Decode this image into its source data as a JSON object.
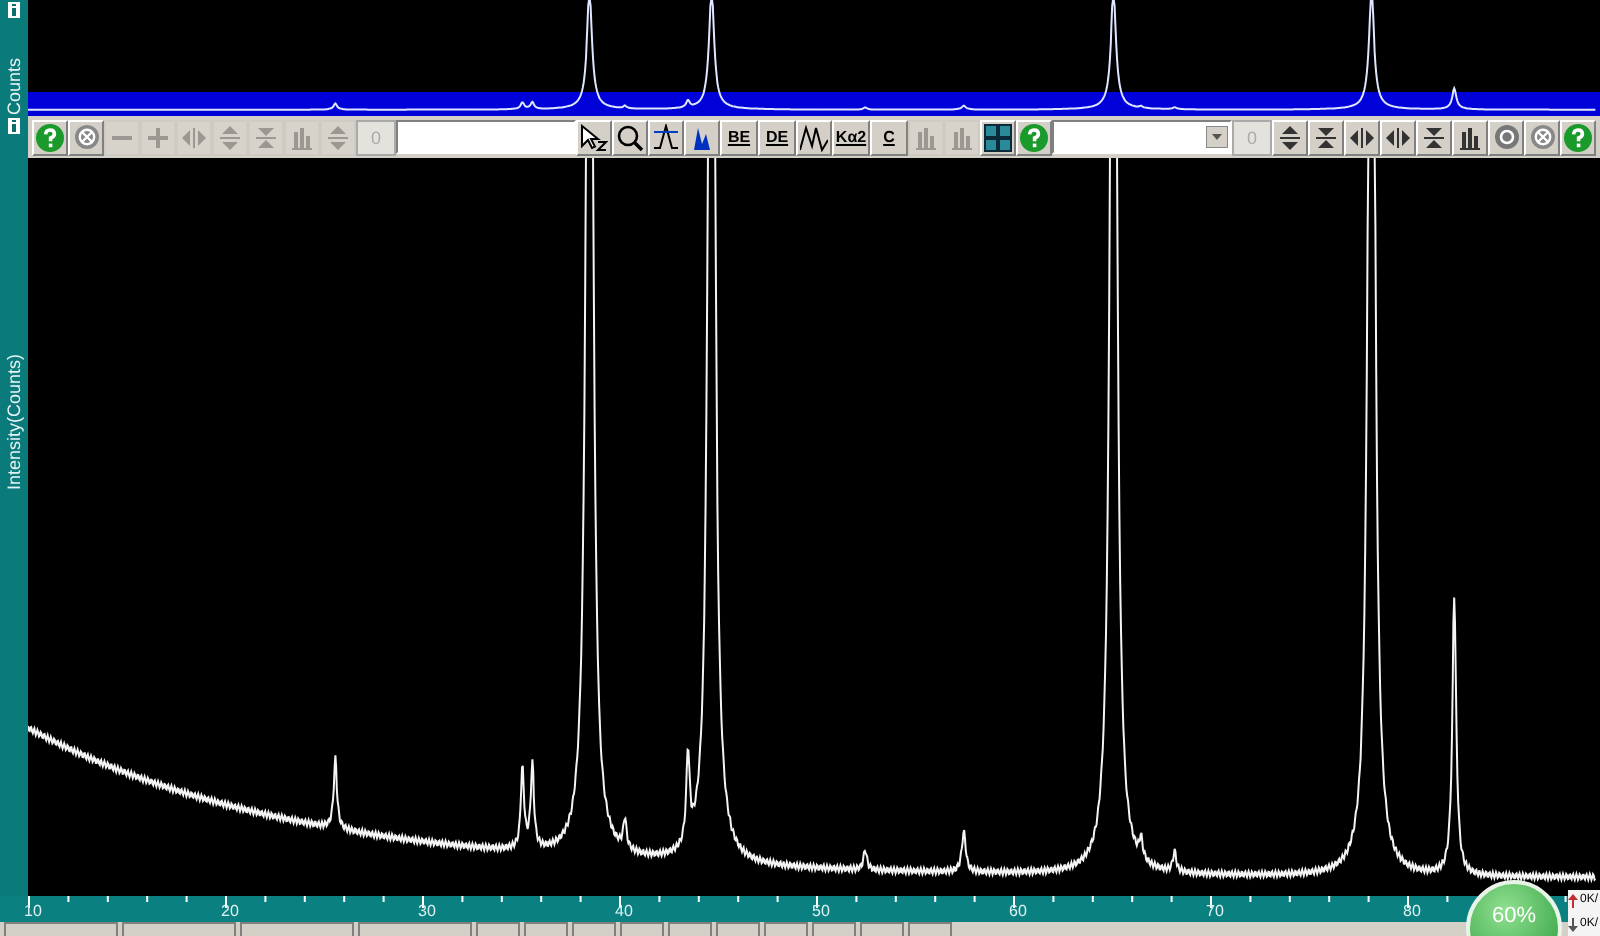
{
  "overview": {
    "axis_label": "Counts"
  },
  "toolbar_left": [
    {
      "kind": "help",
      "disabled": false
    },
    {
      "kind": "cancel",
      "disabled": false
    },
    {
      "kind": "minus",
      "disabled": true
    },
    {
      "kind": "plus",
      "disabled": true
    },
    {
      "kind": "split",
      "disabled": true
    },
    {
      "kind": "updown",
      "disabled": true
    },
    {
      "kind": "join",
      "disabled": true
    },
    {
      "kind": "bars",
      "disabled": true
    },
    {
      "kind": "updown",
      "disabled": true
    },
    {
      "kind": "number",
      "label": "0",
      "disabled": true
    },
    {
      "kind": "input"
    },
    {
      "kind": "cursor",
      "disabled": false
    },
    {
      "kind": "zoom",
      "disabled": false
    },
    {
      "kind": "background",
      "disabled": false
    },
    {
      "kind": "peaks",
      "disabled": false
    },
    {
      "kind": "label",
      "label": "BE",
      "disabled": false
    },
    {
      "kind": "label",
      "label": "DE",
      "disabled": false
    },
    {
      "kind": "wave",
      "disabled": false
    },
    {
      "kind": "label",
      "label": "Kα2",
      "disabled": false
    },
    {
      "kind": "label",
      "label": "C",
      "disabled": false
    },
    {
      "kind": "bars",
      "disabled": true
    },
    {
      "kind": "bars",
      "disabled": true
    },
    {
      "kind": "grid",
      "disabled": false
    },
    {
      "kind": "help",
      "disabled": false
    },
    {
      "kind": "dropdown"
    },
    {
      "kind": "number",
      "label": "0",
      "disabled": true
    },
    {
      "kind": "updown",
      "disabled": false
    },
    {
      "kind": "join",
      "disabled": false
    },
    {
      "kind": "split",
      "disabled": false
    },
    {
      "kind": "split",
      "disabled": false
    },
    {
      "kind": "join",
      "disabled": false
    },
    {
      "kind": "bars",
      "disabled": false
    },
    {
      "kind": "circle",
      "disabled": false
    },
    {
      "kind": "cancel",
      "disabled": false
    },
    {
      "kind": "help",
      "disabled": false
    }
  ],
  "plot": {
    "axis_label": "Intensity(Counts)",
    "x_ticks": [
      "10",
      "20",
      "30",
      "40",
      "50",
      "60",
      "70",
      "80"
    ]
  },
  "status": {
    "progress": "60%",
    "upload": "0K/",
    "download": "0K/"
  }
}
